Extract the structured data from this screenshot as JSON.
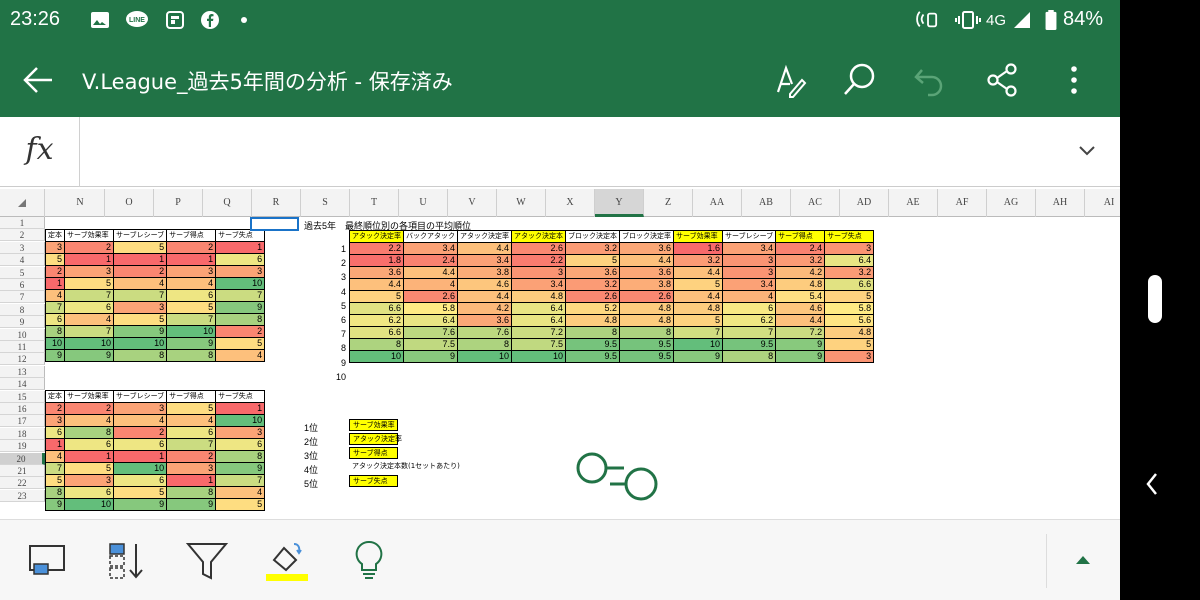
{
  "status": {
    "time": "23:26",
    "network": "4G",
    "battery": "84%"
  },
  "app": {
    "title": "V.League_過去5年間の分析 - 保存済み",
    "fx_label": "fx"
  },
  "columns": [
    "N",
    "O",
    "P",
    "Q",
    "R",
    "S",
    "T",
    "U",
    "V",
    "W",
    "X",
    "Y",
    "Z",
    "AA",
    "AB",
    "AC",
    "AD",
    "AE",
    "AF",
    "AG",
    "AH",
    "AI"
  ],
  "selected_column": "Y",
  "rows": [
    "1",
    "2",
    "3",
    "4",
    "5",
    "6",
    "7",
    "8",
    "9",
    "10",
    "11",
    "12",
    "13",
    "14",
    "15",
    "16",
    "17",
    "18",
    "19",
    "20",
    "21",
    "22",
    "23"
  ],
  "selected_row": "20",
  "left_table_top": {
    "headers": [
      "定本",
      "サーブ効果率",
      "サーブレシーブ",
      "サーブ得点",
      "サーブ失点"
    ],
    "rows": [
      [
        3,
        2,
        5,
        2,
        1
      ],
      [
        5,
        1,
        1,
        1,
        6
      ],
      [
        2,
        3,
        2,
        3,
        3
      ],
      [
        1,
        5,
        4,
        4,
        10
      ],
      [
        4,
        7,
        7,
        6,
        7
      ],
      [
        7,
        6,
        3,
        5,
        9
      ],
      [
        6,
        4,
        5,
        7,
        8
      ],
      [
        8,
        7,
        9,
        10,
        2
      ],
      [
        10,
        10,
        10,
        9,
        5
      ],
      [
        9,
        9,
        8,
        8,
        4
      ]
    ]
  },
  "left_table_bottom": {
    "headers": [
      "定本",
      "サーブ効果率",
      "サーブレシーブ",
      "サーブ得点",
      "サーブ失点"
    ],
    "rows": [
      [
        2,
        2,
        3,
        5,
        1
      ],
      [
        3,
        4,
        4,
        4,
        10
      ],
      [
        6,
        8,
        2,
        6,
        3
      ],
      [
        1,
        6,
        6,
        7,
        6
      ],
      [
        4,
        1,
        1,
        2,
        8
      ],
      [
        7,
        5,
        10,
        3,
        9
      ],
      [
        5,
        3,
        6,
        1,
        7
      ],
      [
        8,
        6,
        5,
        8,
        4
      ],
      [
        9,
        10,
        9,
        9,
        5
      ]
    ]
  },
  "main_title": "過去5年　最終順位別の各項目の平均順位",
  "main_table": {
    "headers": [
      "アタック決定率",
      "バックアタック",
      "アタック決定率",
      "アタック決定本",
      "ブロック決定本",
      "ブロック決定率",
      "サーブ効果率",
      "サーブレシーブ",
      "サーブ得点",
      "サーブ失点"
    ],
    "ranks": [
      1,
      2,
      3,
      4,
      5,
      6,
      7,
      8,
      9,
      10
    ],
    "rows": [
      [
        2.2,
        3.4,
        4.4,
        2.6,
        3.2,
        3.6,
        1.6,
        3.4,
        2.4,
        3
      ],
      [
        1.8,
        2.4,
        3.4,
        2.2,
        5,
        4.4,
        3.2,
        3,
        3.2,
        6.4
      ],
      [
        3.6,
        4.4,
        3.8,
        3,
        3.6,
        3.6,
        4.4,
        3,
        4.2,
        3.2
      ],
      [
        4.4,
        4,
        4.6,
        3.4,
        3.2,
        3.8,
        5,
        3.4,
        4.8,
        6.6
      ],
      [
        5,
        2.6,
        4.4,
        4.8,
        2.6,
        2.6,
        4.4,
        4,
        5.4,
        5
      ],
      [
        6.6,
        5.8,
        4.2,
        6.4,
        5.2,
        4.8,
        4.8,
        6,
        4.6,
        5.8
      ],
      [
        6.2,
        6.4,
        3.6,
        6.4,
        4.8,
        4.8,
        5,
        6.2,
        4.4,
        5.6
      ],
      [
        6.6,
        7.6,
        7.6,
        7.2,
        8,
        8,
        7,
        7,
        7.2,
        4.8
      ],
      [
        8,
        7.5,
        8,
        7.5,
        9.5,
        9.5,
        10,
        9.5,
        9,
        5
      ],
      [
        10,
        9,
        10,
        10,
        9.5,
        9.5,
        9,
        8,
        9,
        3
      ]
    ]
  },
  "ranking": [
    {
      "place": "1位",
      "item": "サーブ効果率"
    },
    {
      "place": "2位",
      "item": "アタック決定率"
    },
    {
      "place": "3位",
      "item": "サーブ得点"
    },
    {
      "place": "4位",
      "item": "アタック決定本数(1セットあたり)"
    },
    {
      "place": "5位",
      "item": "サーブ失点"
    }
  ],
  "colors": {
    "excel_green": "#217346",
    "highlight_yellow": "#ffff00",
    "scale_low": "#63be7b",
    "scale_mid": "#ffeb84",
    "scale_high": "#f8696b"
  }
}
